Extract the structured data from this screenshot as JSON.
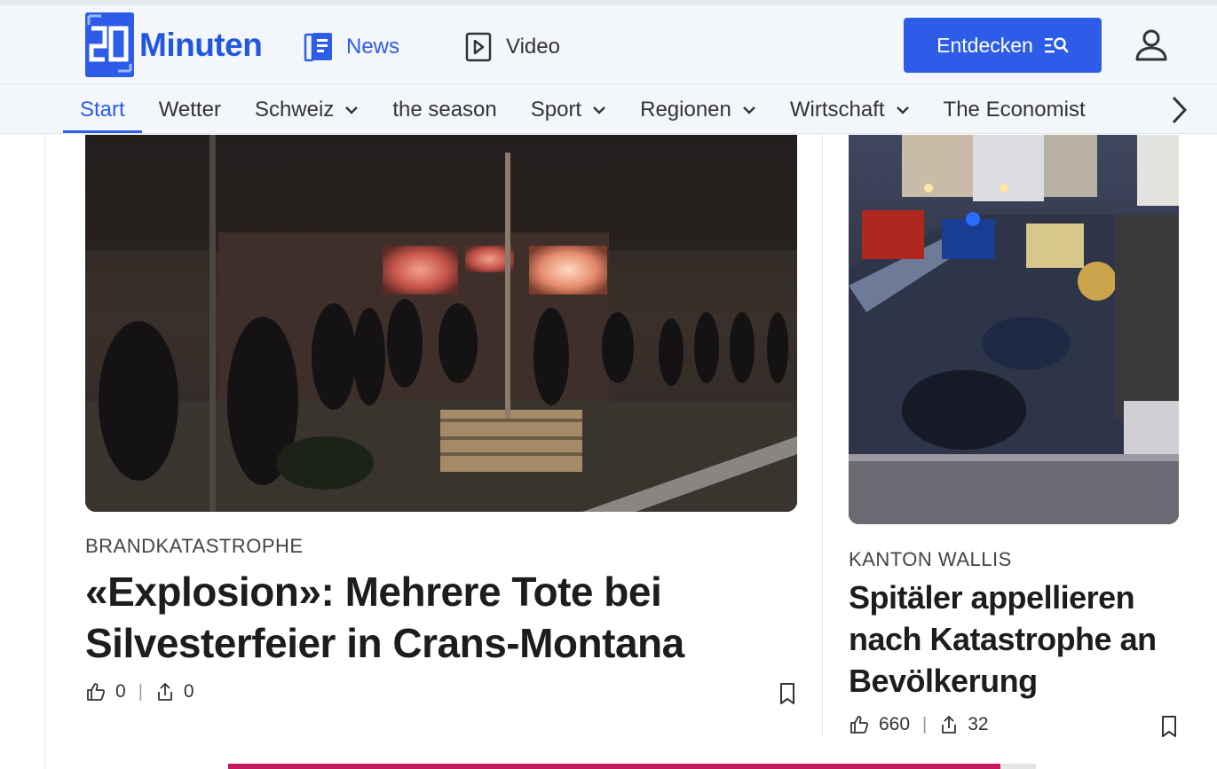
{
  "brand": {
    "logo_text": "Minuten",
    "accent": "#2d5de8"
  },
  "header": {
    "nav": [
      {
        "label": "News",
        "icon": "news-icon",
        "active": true
      },
      {
        "label": "Video",
        "icon": "video-play-icon",
        "active": false
      }
    ],
    "discover_button": "Entdecken",
    "user_icon": "user-icon"
  },
  "categories": {
    "items": [
      "Start",
      "Wetter",
      "Schweiz",
      "the season",
      "Sport",
      "Regionen",
      "Wirtschaft",
      "The Economist"
    ],
    "active": "Start",
    "dropdown": [
      "Schweiz",
      "Sport",
      "Regionen",
      "Wirtschaft"
    ]
  },
  "articles": {
    "main": {
      "kicker": "BRANDKATASTROPHE",
      "headline": "«Explosion»: Mehrere Tote bei Silvesterfeier in Crans-Montana",
      "likes": "0",
      "shares": "0"
    },
    "side": {
      "kicker": "KANTON WALLIS",
      "headline": "Spitäler appellieren nach Katastrophe an Bevölkerung",
      "likes": "660",
      "shares": "32"
    }
  }
}
